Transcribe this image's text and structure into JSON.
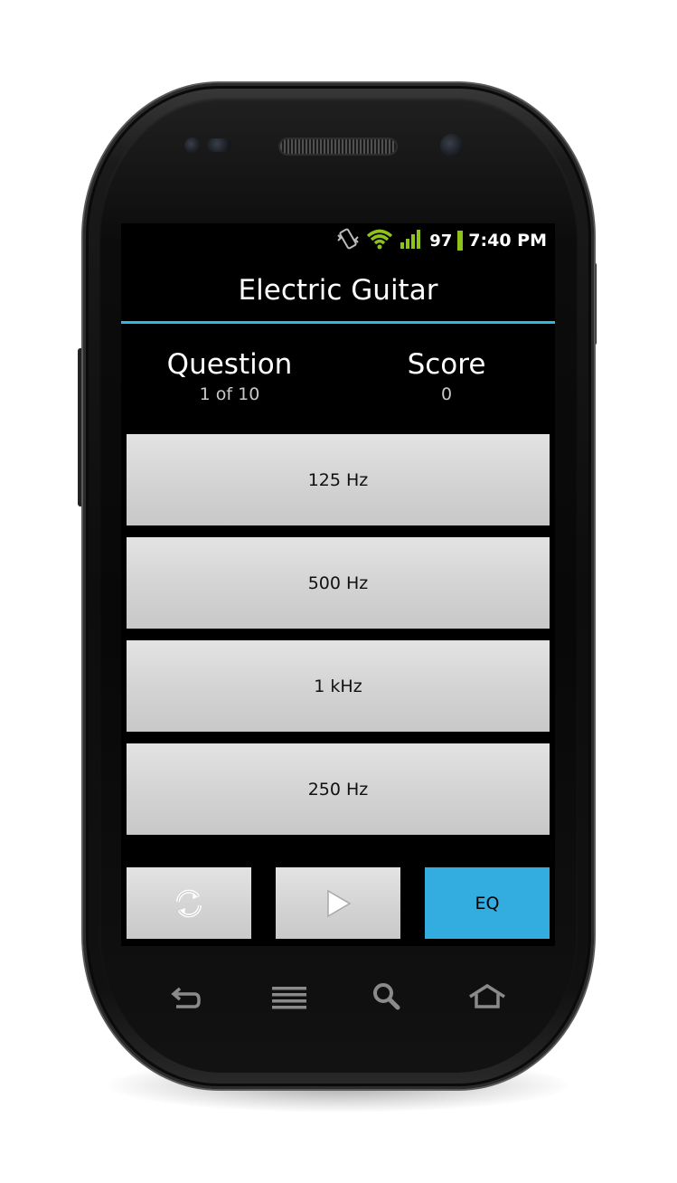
{
  "status_bar": {
    "battery_percent": "97",
    "time": "7:40 PM",
    "icons": [
      "vibrate-icon",
      "wifi-icon",
      "signal-icon",
      "battery-icon"
    ],
    "accent_color": "#8fc21a"
  },
  "header": {
    "title": "Electric Guitar",
    "accent_color": "#33b5e5"
  },
  "stats": {
    "question_label": "Question",
    "question_value": "1 of 10",
    "score_label": "Score",
    "score_value": "0"
  },
  "answers": [
    {
      "label": "125 Hz"
    },
    {
      "label": "500 Hz"
    },
    {
      "label": "1 kHz"
    },
    {
      "label": "250 Hz"
    }
  ],
  "controls": {
    "refresh_icon": "refresh-icon",
    "play_icon": "play-icon",
    "eq_label": "EQ",
    "eq_color": "#33ade0"
  },
  "nav_keys": [
    "back-icon",
    "menu-icon",
    "search-icon",
    "home-icon"
  ]
}
